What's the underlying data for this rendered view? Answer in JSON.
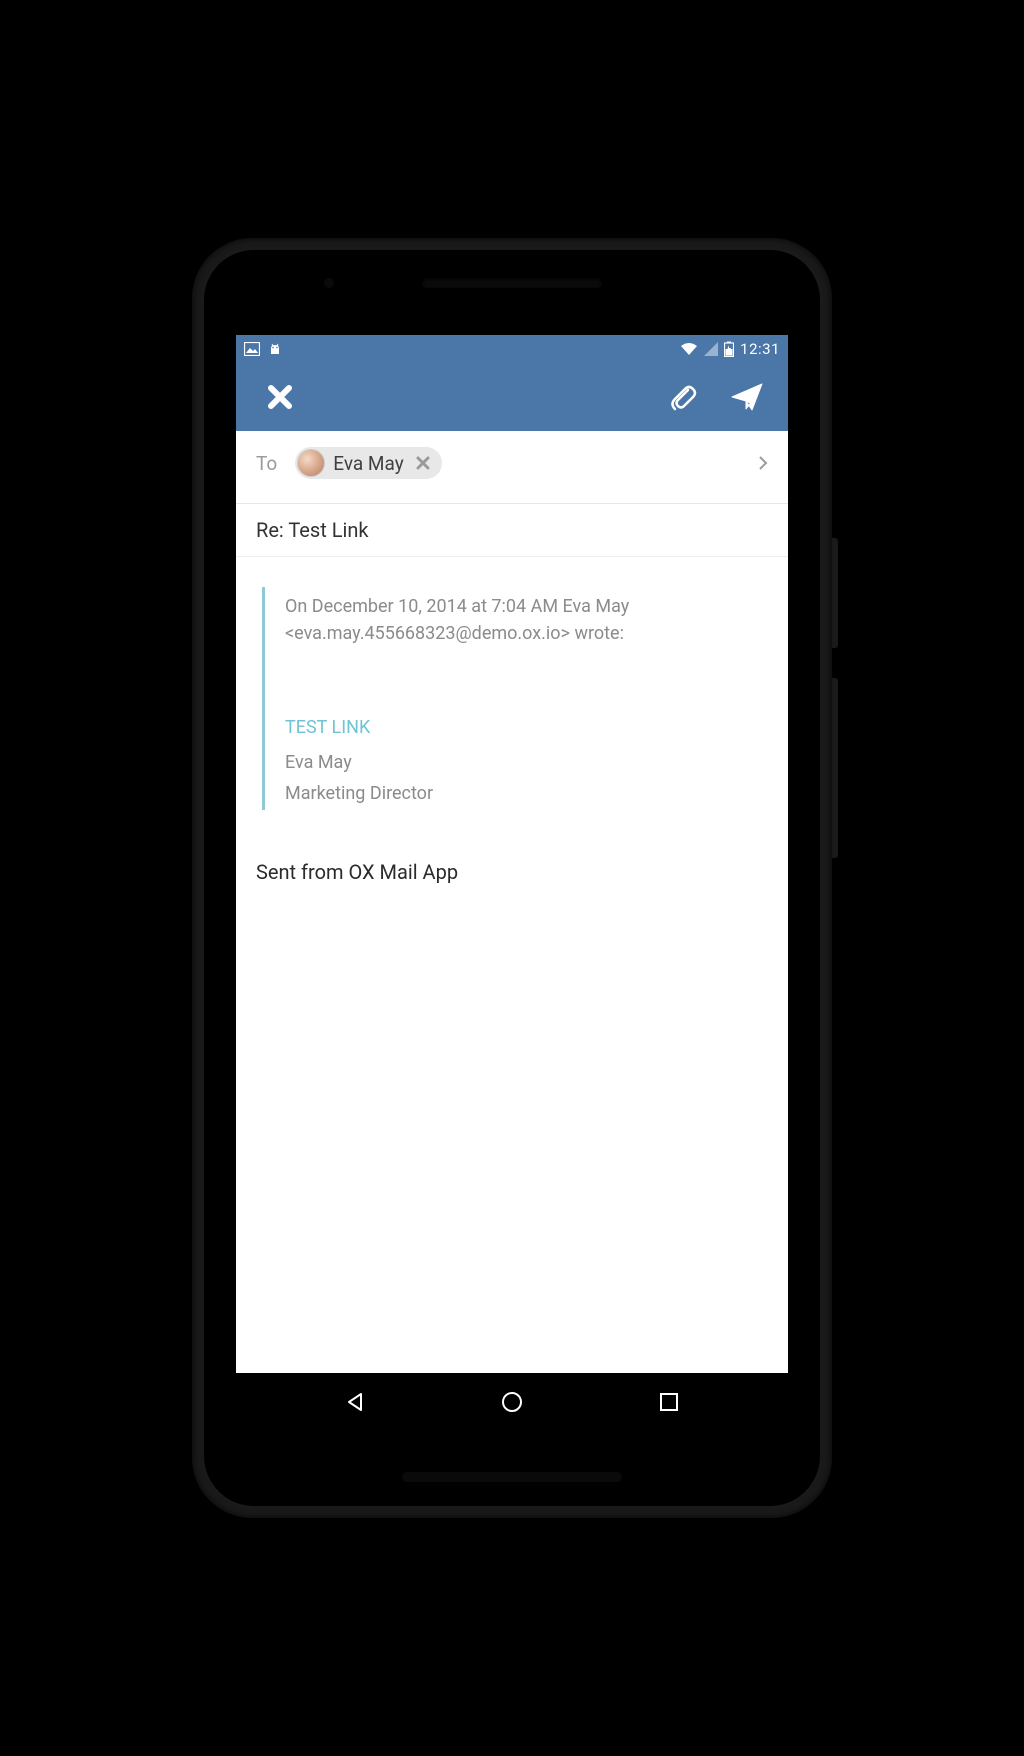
{
  "status_bar": {
    "time": "12:31"
  },
  "app_bar": {
    "close_label": "Close",
    "attach_label": "Attach",
    "send_label": "Send"
  },
  "compose": {
    "to_label": "To",
    "recipients": [
      {
        "name": "Eva May"
      }
    ],
    "subject": "Re: Test Link",
    "quote": {
      "header": "On December 10, 2014 at 7:04 AM Eva May <eva.may.455668323@demo.ox.io> wrote:",
      "link_text": "TEST LINK",
      "signature_name": "Eva May",
      "signature_title": "Marketing Director"
    },
    "signature": "Sent from OX Mail App"
  }
}
